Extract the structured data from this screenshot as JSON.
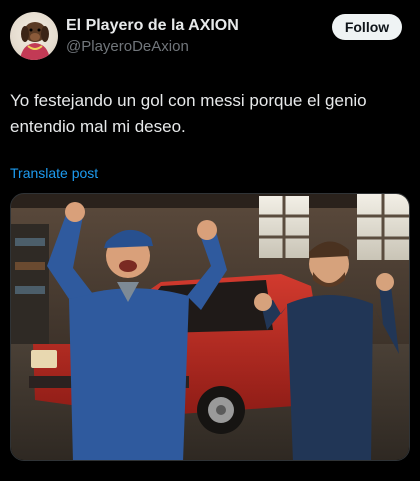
{
  "author": {
    "display_name": "El Playero de la AXION",
    "handle": "@PlayeroDeAxion",
    "avatar_icon": "dog-avatar"
  },
  "actions": {
    "follow_label": "Follow"
  },
  "post": {
    "text": "Yo festejando un gol con messi porque el genio entendio mal mi deseo.",
    "translate_label": "Translate post"
  },
  "media": {
    "kind": "photo",
    "icon": "photo-image"
  },
  "colors": {
    "background": "#000000",
    "text": "#e7e9ea",
    "secondary_text": "#71767b",
    "link": "#1d9bf0",
    "follow_bg": "#eff3f4"
  }
}
